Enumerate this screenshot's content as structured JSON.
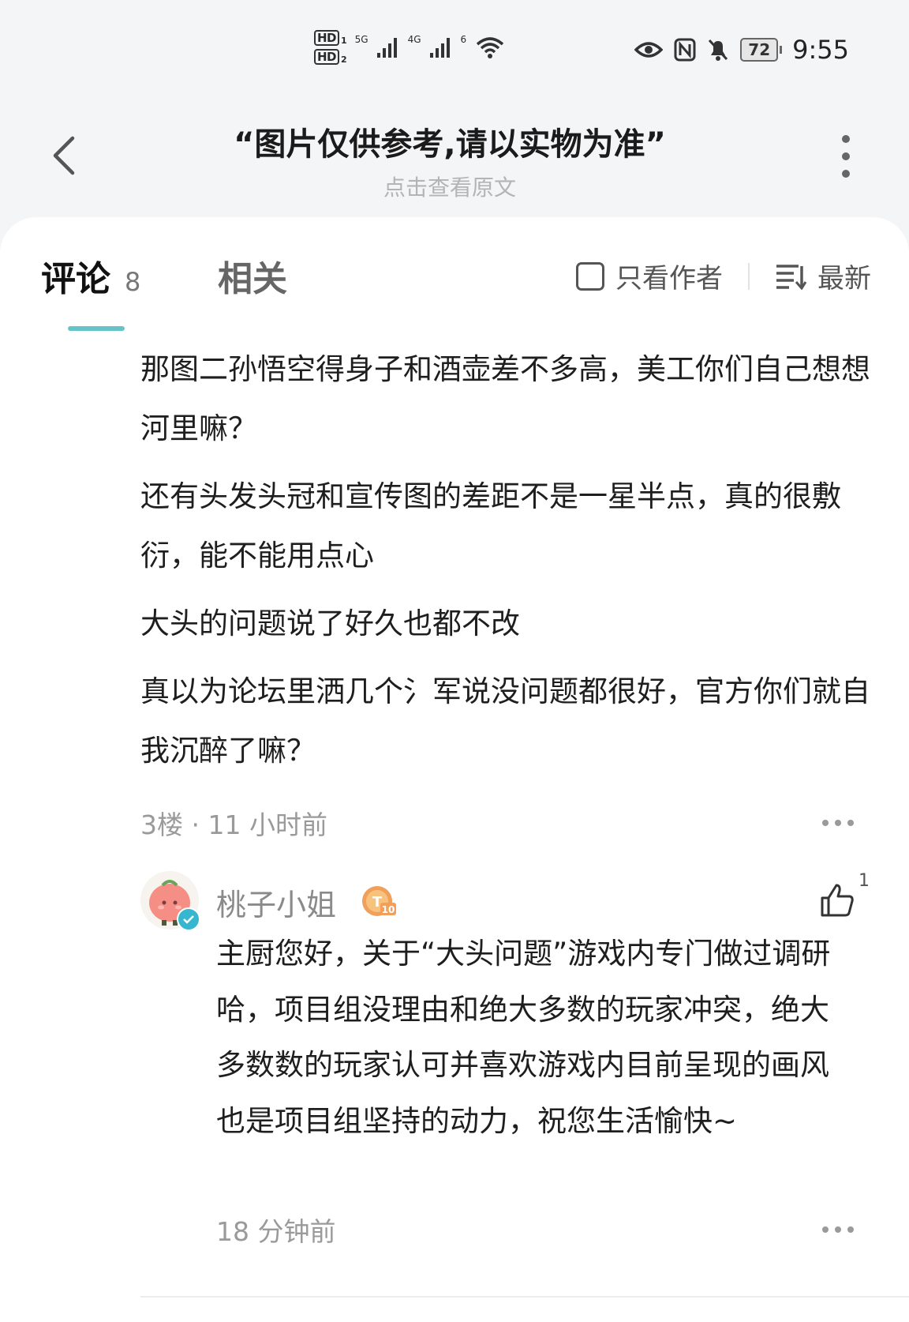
{
  "status_bar": {
    "hd1": "HD",
    "hd1_sim": "1",
    "hd2": "HD",
    "hd2_sim": "2",
    "net1": "5G",
    "net2": "4G",
    "wifi_label": "6",
    "battery": "72",
    "time": "9:55"
  },
  "header": {
    "title": "“图片仅供参考,请以实物为准”",
    "subtitle": "点击查看原文"
  },
  "tabs": {
    "comments_label": "评论",
    "comments_count": "8",
    "related_label": "相关",
    "author_only_label": "只看作者",
    "sort_label": "最新"
  },
  "comment": {
    "paragraphs": [
      "那图二孙悟空得身子和酒壶差不多高，美工你们自己想想河里嘛？",
      "还有头发头冠和宣传图的差距不是一星半点，真的很敷衍，能不能用点心",
      "大头的问题说了好久也都不改",
      "真以为论坛里洒几个氵军说没问题都很好，官方你们就自我沉醉了嘛？"
    ],
    "meta": "3楼 · 11 小时前"
  },
  "reply": {
    "name": "桃子小姐",
    "level_text": "T10",
    "likes": "1",
    "text": "主厨您好，关于“大头问题”游戏内专门做过调研哈，项目组没理由和绝大多数的玩家冲突，绝大多数数的玩家认可并喜欢游戏内目前呈现的画风也是项目组坚持的动力，祝您生活愉快~",
    "time": "18 分钟前"
  },
  "colors": {
    "accent": "#66c4c8",
    "verified": "#37b6cf",
    "level_badge": "#f0a05a"
  }
}
